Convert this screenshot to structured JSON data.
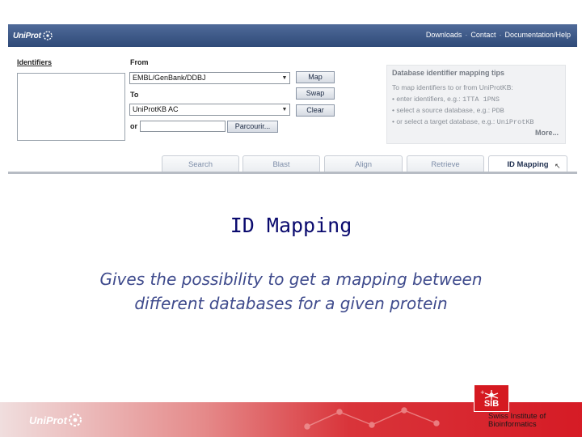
{
  "topbar": {
    "logo": "UniProt",
    "nav": [
      "Downloads",
      "Contact",
      "Documentation/Help"
    ],
    "separator": "·"
  },
  "form": {
    "identifiers_label": "Identifiers",
    "from_label": "From",
    "from_value": "EMBL/GenBank/DDBJ",
    "to_label": "To",
    "to_value": "UniProtKB AC",
    "or_label": "or",
    "browse_button": "Parcourir...",
    "map_button": "Map",
    "swap_button": "Swap",
    "clear_button": "Clear"
  },
  "tips": {
    "title": "Database identifier mapping tips",
    "intro": "To map identifiers to or from UniProtKB:",
    "bullet1_text": "• enter identifiers, e.g.:",
    "bullet1_code": "1TTA 1PNS",
    "bullet2_text": "• select a source database, e.g.:",
    "bullet2_code": "PDB",
    "bullet3_text": "• or select a target database, e.g.:",
    "bullet3_code": "UniProtKB",
    "more": "More..."
  },
  "tabs": [
    {
      "label": "Search",
      "active": false
    },
    {
      "label": "Blast",
      "active": false
    },
    {
      "label": "Align",
      "active": false
    },
    {
      "label": "Retrieve",
      "active": false
    },
    {
      "label": "ID Mapping",
      "active": true
    }
  ],
  "slide": {
    "title": "ID Mapping",
    "body": "Gives the possibility to get a mapping between\ndifferent databases for a given protein"
  },
  "footer": {
    "logo": "UniProt",
    "sib_badge": "SIB",
    "sib_line1": "Swiss Institute of",
    "sib_line2": "Bioinformatics"
  },
  "colors": {
    "topbar": "#3a5585",
    "title": "#0a0a6e",
    "body": "#3e4a8c",
    "footer_red": "#d61b25"
  }
}
